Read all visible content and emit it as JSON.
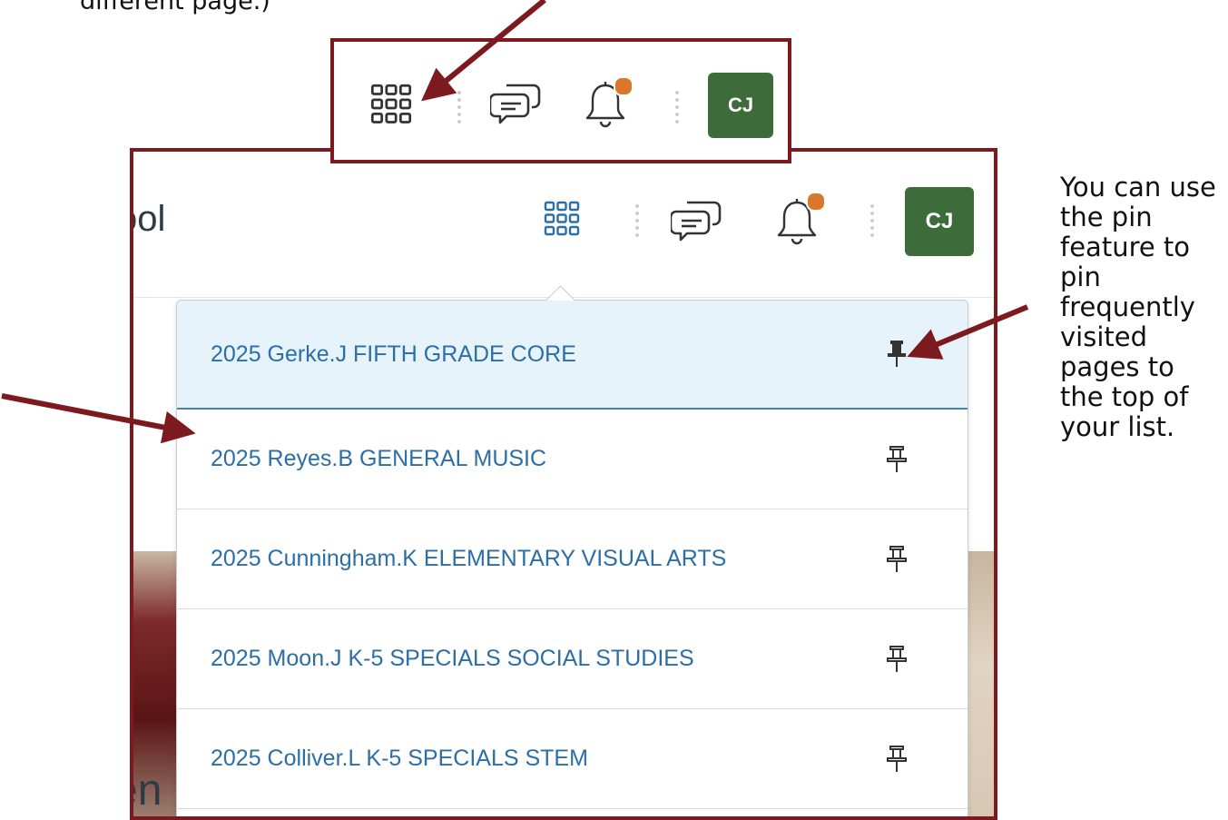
{
  "annotations": {
    "top_caption": "different page.)",
    "right_caption": "You can use the pin feature to pin frequently visited pages to the top of your list."
  },
  "header": {
    "school_name_partial": "ool",
    "avatar_initials": "CJ",
    "icons": [
      "app-grid-icon",
      "messages-icon",
      "notifications-bell-icon"
    ],
    "notification_badge_color": "#d9782d",
    "avatar_color": "#3e6b3a"
  },
  "banner": {
    "bottom_text_partial": "en"
  },
  "course_list": {
    "items": [
      {
        "label": "2025 Gerke.J FIFTH GRADE CORE",
        "pinned": true,
        "highlighted": true
      },
      {
        "label": "2025 Reyes.B GENERAL MUSIC",
        "pinned": false
      },
      {
        "label": "2025 Cunningham.K ELEMENTARY VISUAL ARTS",
        "pinned": false
      },
      {
        "label": "2025 Moon.J K-5 SPECIALS SOCIAL STUDIES",
        "pinned": false
      },
      {
        "label": "2025 Colliver.L K-5 SPECIALS STEM",
        "pinned": false
      }
    ]
  },
  "colors": {
    "annotation_border": "#7d1a1f",
    "link": "#2b6ea8",
    "active_row_bg": "#e7f3fb",
    "grid_icon_active": "#2b6ea8"
  }
}
